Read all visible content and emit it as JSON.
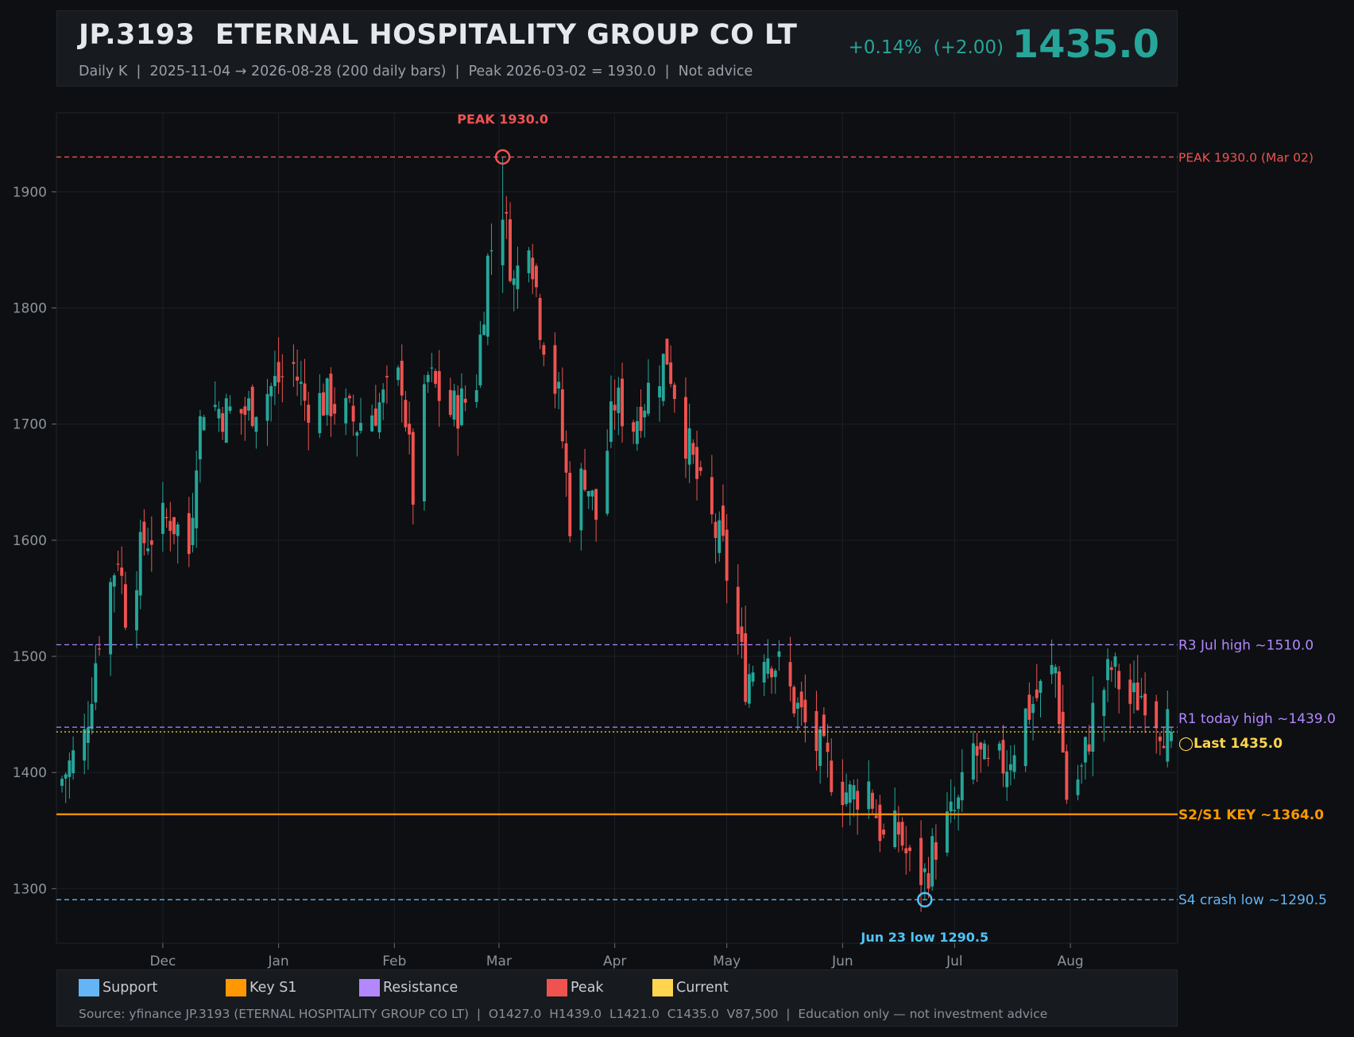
{
  "header": {
    "title": "JP.3193  ETERNAL HOSPITALITY GROUP CO LT",
    "subtitle": "Daily K  |  2025-11-04 → 2026-08-28 (200 daily bars)  |  Peak 2026-03-02 = 1930.0  |  Not advice",
    "change": "+0.14%  (+2.00)",
    "price": "1435.0"
  },
  "legend": {
    "items": [
      {
        "label": "Support",
        "color": "#64b5f6"
      },
      {
        "label": "Key S1",
        "color": "#ff9800"
      },
      {
        "label": "Resistance",
        "color": "#b388ff"
      },
      {
        "label": "Peak",
        "color": "#ef5350"
      },
      {
        "label": "Current",
        "color": "#ffd54f"
      }
    ],
    "source": "Source: yfinance JP.3193 (ETERNAL HOSPITALITY GROUP CO LT)  |  O1427.0  H1439.0  L1421.0  C1435.0  V87,500  |  Education only — not investment advice"
  },
  "chart_data": {
    "type": "candlestick",
    "ylim": [
      1253,
      1968
    ],
    "yticks": [
      1300,
      1400,
      1500,
      1600,
      1700,
      1800,
      1900
    ],
    "xticks": [
      {
        "label": "Dec",
        "date": "2025-12-01"
      },
      {
        "label": "Jan",
        "date": "2026-01-01"
      },
      {
        "label": "Feb",
        "date": "2026-02-01"
      },
      {
        "label": "Mar",
        "date": "2026-03-01"
      },
      {
        "label": "Apr",
        "date": "2026-04-01"
      },
      {
        "label": "May",
        "date": "2026-05-01"
      },
      {
        "label": "Jun",
        "date": "2026-06-01"
      },
      {
        "label": "Jul",
        "date": "2026-07-01"
      },
      {
        "label": "Aug",
        "date": "2026-08-01"
      }
    ],
    "date_range": [
      "2025-11-04",
      "2026-08-28"
    ],
    "bars": 200,
    "colors": {
      "up": "#26a69a",
      "down": "#ef5350"
    },
    "anchors": [
      [
        "2025-11-04",
        1395
      ],
      [
        "2025-11-10",
        1430
      ],
      [
        "2025-11-14",
        1520
      ],
      [
        "2025-11-19",
        1590
      ],
      [
        "2025-11-21",
        1540
      ],
      [
        "2025-11-26",
        1600
      ],
      [
        "2025-12-03",
        1620
      ],
      [
        "2025-12-05",
        1610
      ],
      [
        "2025-12-08",
        1590
      ],
      [
        "2025-12-10",
        1680
      ],
      [
        "2025-12-12",
        1720
      ],
      [
        "2025-12-18",
        1710
      ],
      [
        "2025-12-23",
        1710
      ],
      [
        "2026-01-05",
        1750
      ],
      [
        "2026-01-08",
        1720
      ],
      [
        "2026-01-15",
        1720
      ],
      [
        "2026-01-22",
        1700
      ],
      [
        "2026-01-29",
        1720
      ],
      [
        "2026-02-03",
        1740
      ],
      [
        "2026-02-06",
        1640
      ],
      [
        "2026-02-10",
        1740
      ],
      [
        "2026-02-16",
        1710
      ],
      [
        "2026-02-20",
        1720
      ],
      [
        "2026-02-23",
        1740
      ],
      [
        "2026-02-26",
        1840
      ],
      [
        "2026-03-02",
        1890
      ],
      [
        "2026-03-05",
        1820
      ],
      [
        "2026-03-09",
        1870
      ],
      [
        "2026-03-12",
        1790
      ],
      [
        "2026-03-17",
        1720
      ],
      [
        "2026-03-20",
        1620
      ],
      [
        "2026-03-24",
        1660
      ],
      [
        "2026-03-27",
        1620
      ],
      [
        "2026-04-01",
        1720
      ],
      [
        "2026-04-06",
        1700
      ],
      [
        "2026-04-10",
        1730
      ],
      [
        "2026-04-15",
        1760
      ],
      [
        "2026-04-20",
        1690
      ],
      [
        "2026-04-24",
        1640
      ],
      [
        "2026-04-30",
        1590
      ],
      [
        "2026-05-06",
        1480
      ],
      [
        "2026-05-11",
        1510
      ],
      [
        "2026-05-15",
        1490
      ],
      [
        "2026-05-22",
        1440
      ],
      [
        "2026-05-29",
        1400
      ],
      [
        "2026-06-03",
        1380
      ],
      [
        "2026-06-08",
        1390
      ],
      [
        "2026-06-12",
        1340
      ],
      [
        "2026-06-16",
        1350
      ],
      [
        "2026-06-19",
        1320
      ],
      [
        "2026-06-23",
        1310
      ],
      [
        "2026-06-26",
        1340
      ],
      [
        "2026-07-02",
        1370
      ],
      [
        "2026-07-06",
        1420
      ],
      [
        "2026-07-10",
        1400
      ],
      [
        "2026-07-15",
        1410
      ],
      [
        "2026-07-20",
        1450
      ],
      [
        "2026-07-24",
        1470
      ],
      [
        "2026-07-28",
        1490
      ],
      [
        "2026-07-31",
        1380
      ],
      [
        "2026-08-04",
        1400
      ],
      [
        "2026-08-07",
        1450
      ],
      [
        "2026-08-12",
        1490
      ],
      [
        "2026-08-17",
        1460
      ],
      [
        "2026-08-21",
        1470
      ],
      [
        "2026-08-25",
        1445
      ],
      [
        "2026-08-28",
        1435
      ]
    ],
    "levels": [
      {
        "label": "PEAK 1930.0 (Mar 02)",
        "value": 1930.0,
        "color": "#ef5350",
        "style": "dashed"
      },
      {
        "label": "R3 Jul high ~1510.0",
        "value": 1510.0,
        "color": "#b388ff",
        "style": "dashed"
      },
      {
        "label": "R1 today high ~1439.0",
        "value": 1439.0,
        "color": "#b388ff",
        "style": "dashed"
      },
      {
        "label": "◯Last 1435.0",
        "value": 1435.0,
        "color": "#ffd54f",
        "style": "dotted",
        "bold": true
      },
      {
        "label": "S2/S1 KEY ~1364.0",
        "value": 1364.0,
        "color": "#ff9800",
        "style": "solid",
        "bold": true
      },
      {
        "label": "S4 crash low ~1290.5",
        "value": 1290.5,
        "color": "#64b5f6",
        "style": "dashed"
      }
    ],
    "annotations": [
      {
        "text": "PEAK 1930.0",
        "date": "2026-03-02",
        "value": 1930.0,
        "color": "#ef5350",
        "position": "above"
      },
      {
        "text": "Jun 23 low 1290.5",
        "date": "2026-06-23",
        "value": 1290.5,
        "color": "#4fc3f7",
        "position": "below"
      }
    ]
  }
}
